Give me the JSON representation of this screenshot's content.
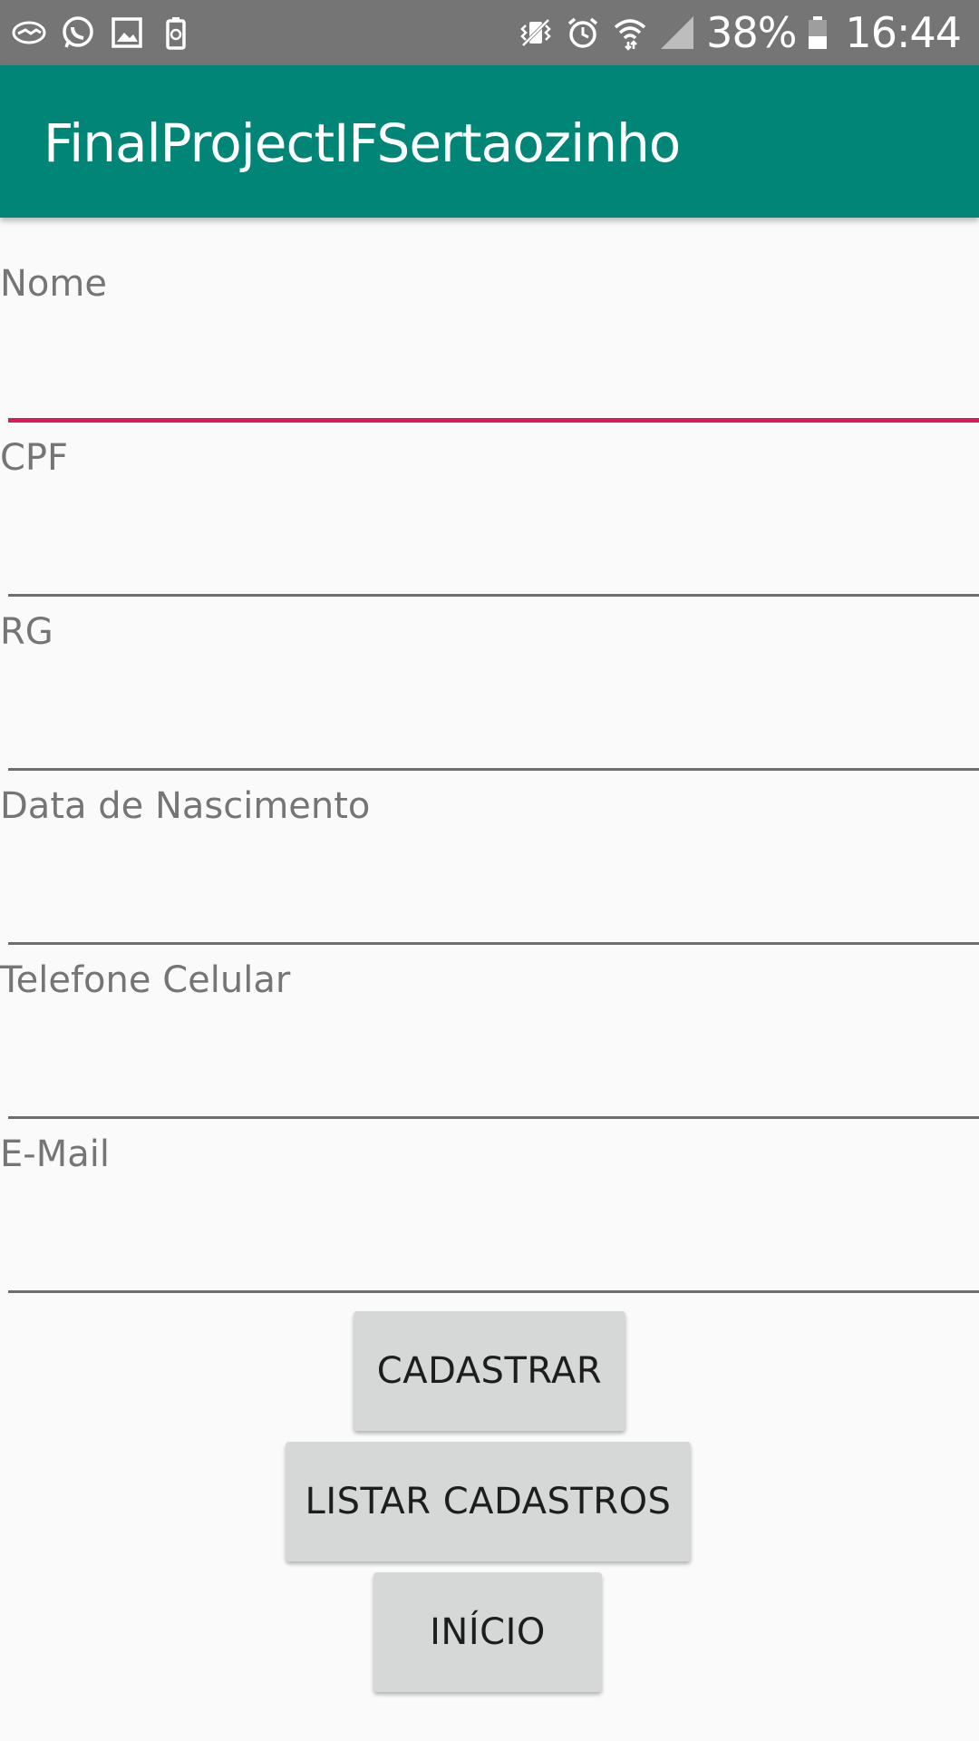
{
  "status_bar": {
    "left_icons": [
      "handshake-icon",
      "whatsapp-icon",
      "gallery-icon",
      "battery-saver-icon"
    ],
    "right_icons": [
      "vibrate-icon",
      "alarm-icon",
      "wifi-icon",
      "signal-icon"
    ],
    "battery_percent": "38%",
    "time": "16:44"
  },
  "app_bar": {
    "title": "FinalProjectIFSertaozinho"
  },
  "form": {
    "fields": [
      {
        "label": "Nome",
        "value": ""
      },
      {
        "label": "CPF",
        "value": ""
      },
      {
        "label": "RG",
        "value": ""
      },
      {
        "label": "Data de Nascimento",
        "value": ""
      },
      {
        "label": "Telefone Celular",
        "value": ""
      },
      {
        "label": "E-Mail",
        "value": ""
      }
    ]
  },
  "buttons": {
    "cadastrar": "CADASTRAR",
    "listar": "LISTAR CADASTROS",
    "inicio": "INÍCIO"
  },
  "colors": {
    "primary": "#008577",
    "accent": "#D81B60",
    "status_bar": "#757575",
    "button_bg": "#D6D7D7"
  }
}
